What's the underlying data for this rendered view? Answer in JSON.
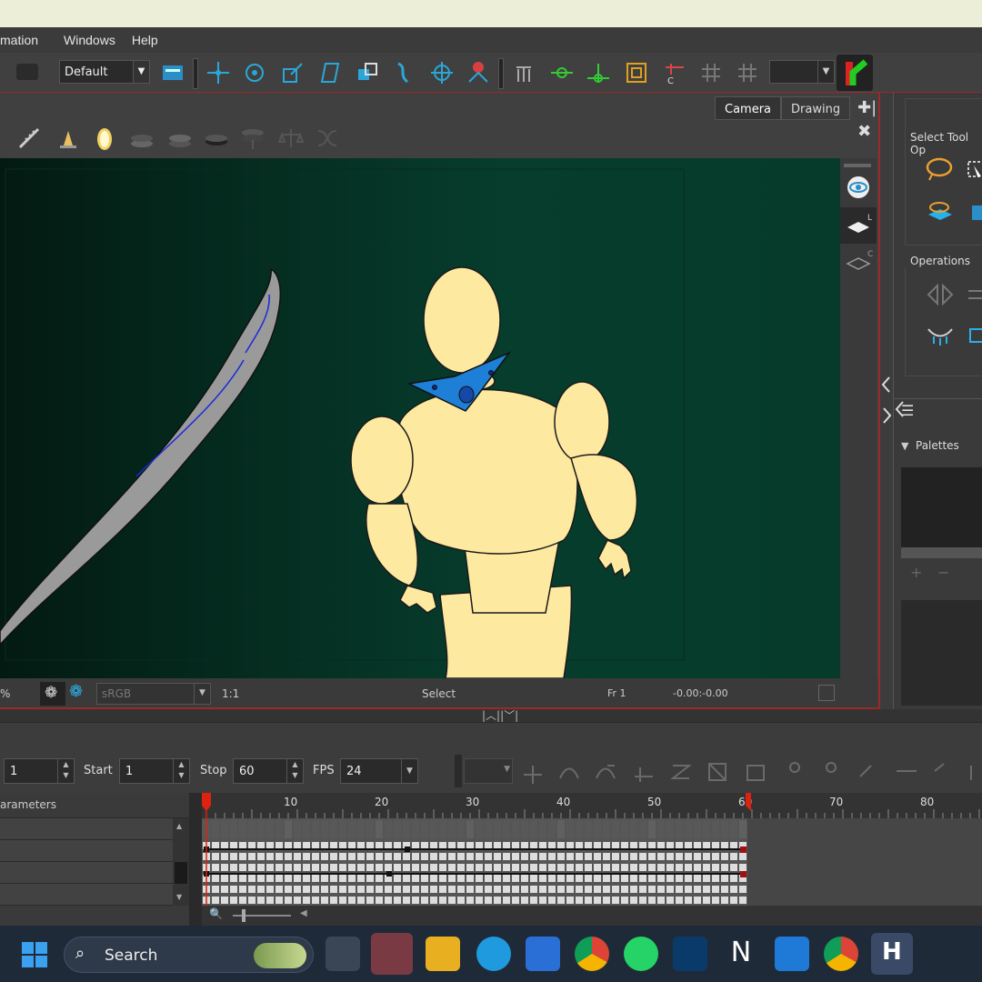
{
  "menubar": {
    "items": [
      "mation",
      "Windows",
      "Help"
    ]
  },
  "toolbar": {
    "workspace": "Default"
  },
  "view": {
    "tabs": [
      "Camera",
      "Drawing"
    ],
    "status": {
      "zoom": "%",
      "color_space": "sRGB",
      "ratio": "1:1",
      "tool": "Select",
      "frame": "Fr 1",
      "coords": "-0.00:-0.00"
    }
  },
  "right_panel": {
    "title": "Select Tool Op",
    "operations": "Operations",
    "palettes": "Palettes"
  },
  "timeline": {
    "frame_value": "1",
    "start_label": "Start",
    "start_value": "1",
    "stop_label": "Stop",
    "stop_value": "60",
    "fps_label": "FPS",
    "fps_value": "24",
    "params_header": "arameters",
    "ruler": [
      "10",
      "20",
      "30",
      "40",
      "50",
      "60",
      "70",
      "80"
    ]
  },
  "taskbar": {
    "search_label": "Search"
  },
  "colors": {
    "accent_red": "#c0272d",
    "canvas_green": "#063d2d",
    "puppet": "#fde9a0",
    "mask_blue": "#1e7fd6"
  }
}
